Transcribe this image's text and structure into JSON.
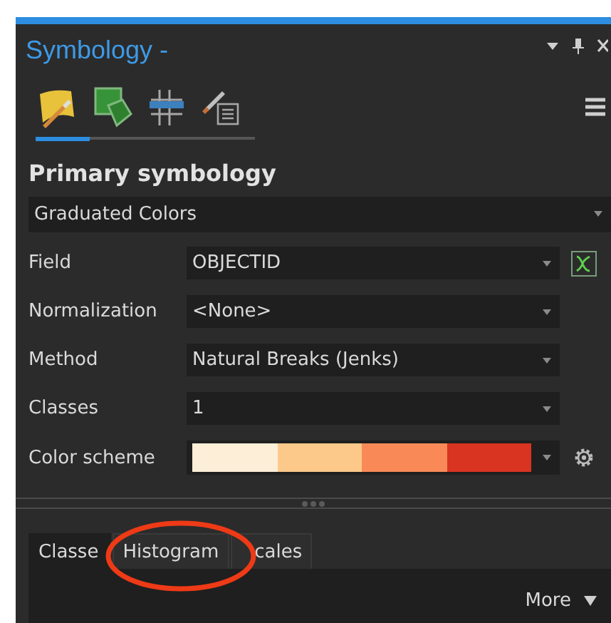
{
  "pane": {
    "title": "Symbology -"
  },
  "symbol_tabs": [
    {
      "kind": "fill",
      "selected": true
    },
    {
      "kind": "polygon",
      "selected": false
    },
    {
      "kind": "grid",
      "selected": false
    },
    {
      "kind": "brush",
      "selected": false
    }
  ],
  "section_title": "Primary symbology",
  "renderer": {
    "value": "Graduated Colors"
  },
  "fields": [
    {
      "label": "Field",
      "kind": "text",
      "value": "OBJECTID",
      "expression_button": true
    },
    {
      "label": "Normalization",
      "kind": "text",
      "value": "<None>"
    },
    {
      "label": "Method",
      "kind": "text",
      "value": "Natural Breaks (Jenks)"
    },
    {
      "label": "Classes",
      "kind": "text",
      "value": "1"
    },
    {
      "label": "Color scheme",
      "kind": "ramp",
      "stops": [
        {
          "color": "#fdeed8"
        },
        {
          "color": "#fdc98a"
        },
        {
          "color": "#f98a58"
        },
        {
          "color": "#d93421"
        }
      ],
      "settings_button": true
    }
  ],
  "tabs": [
    {
      "label": "Classe",
      "selected": true
    },
    {
      "label": "Histogram",
      "selected": false
    },
    {
      "label": "cales",
      "selected": false
    }
  ],
  "more": {
    "label": "More"
  }
}
